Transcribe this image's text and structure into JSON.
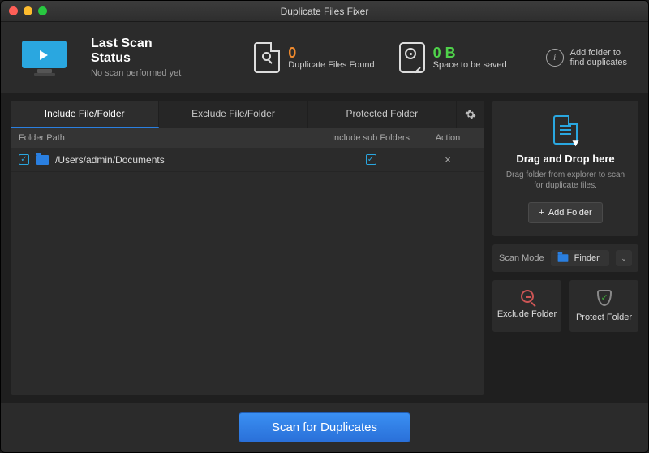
{
  "window": {
    "title": "Duplicate Files Fixer"
  },
  "header": {
    "status": {
      "line1": "Last Scan",
      "line2": "Status",
      "sub": "No scan performed yet"
    },
    "filesFound": {
      "count": "0",
      "label": "Duplicate Files Found"
    },
    "spaceSaved": {
      "amount": "0 B",
      "label": "Space to be saved"
    },
    "info": {
      "line1": "Add folder to",
      "line2": "find duplicates"
    }
  },
  "tabs": {
    "include": "Include File/Folder",
    "exclude": "Exclude File/Folder",
    "protected": "Protected Folder"
  },
  "columns": {
    "path": "Folder Path",
    "sub": "Include sub Folders",
    "action": "Action"
  },
  "rows": [
    {
      "path": "/Users/admin/Documents",
      "includeSub": true
    }
  ],
  "drop": {
    "heading": "Drag and Drop here",
    "desc": "Drag folder from explorer to scan for duplicate files.",
    "addBtn": "Add Folder"
  },
  "scanMode": {
    "label": "Scan Mode",
    "value": "Finder"
  },
  "actions": {
    "exclude": "Exclude Folder",
    "protect": "Protect Folder"
  },
  "footer": {
    "scan": "Scan for Duplicates"
  }
}
